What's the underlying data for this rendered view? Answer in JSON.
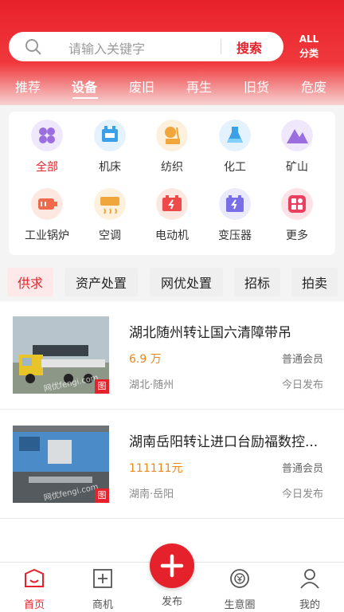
{
  "search": {
    "placeholder": "请输入关键字",
    "button": "搜索"
  },
  "all_categories": {
    "line1": "ALL",
    "line2": "分类"
  },
  "tabs": [
    {
      "label": "推荐"
    },
    {
      "label": "设备"
    },
    {
      "label": "废旧"
    },
    {
      "label": "再生"
    },
    {
      "label": "旧货"
    },
    {
      "label": "危废"
    }
  ],
  "categories": [
    {
      "label": "全部",
      "icon": "grid-flower-icon"
    },
    {
      "label": "机床",
      "icon": "machine-tool-icon"
    },
    {
      "label": "纺织",
      "icon": "textile-icon"
    },
    {
      "label": "化工",
      "icon": "flask-icon"
    },
    {
      "label": "矿山",
      "icon": "mountain-icon"
    },
    {
      "label": "工业锅炉",
      "icon": "boiler-icon"
    },
    {
      "label": "空调",
      "icon": "air-conditioner-icon"
    },
    {
      "label": "电动机",
      "icon": "battery-motor-icon"
    },
    {
      "label": "变压器",
      "icon": "transformer-icon"
    },
    {
      "label": "更多",
      "icon": "more-apps-icon"
    }
  ],
  "chips": [
    {
      "label": "供求"
    },
    {
      "label": "资产处置"
    },
    {
      "label": "网优处置"
    },
    {
      "label": "招标"
    },
    {
      "label": "拍卖"
    }
  ],
  "listings": [
    {
      "title": "湖北随州转让国六清障带吊",
      "price": "6.9 万",
      "member": "普通会员",
      "location": "湖北·随州",
      "posted": "今日发布",
      "tag": "图",
      "watermark": "网优fengi.com"
    },
    {
      "title": "湖南岳阳转让进口台励福数控...",
      "price": "111111元",
      "member": "普通会员",
      "location": "湖南·岳阳",
      "posted": "今日发布",
      "tag": "图",
      "watermark": "网优fengi.com"
    }
  ],
  "bottom_nav": [
    {
      "label": "首页"
    },
    {
      "label": "商机"
    },
    {
      "label": "发布"
    },
    {
      "label": "生意圈"
    },
    {
      "label": "我的"
    }
  ],
  "colors": {
    "brand": "#e5222b",
    "price": "#e8871a"
  }
}
